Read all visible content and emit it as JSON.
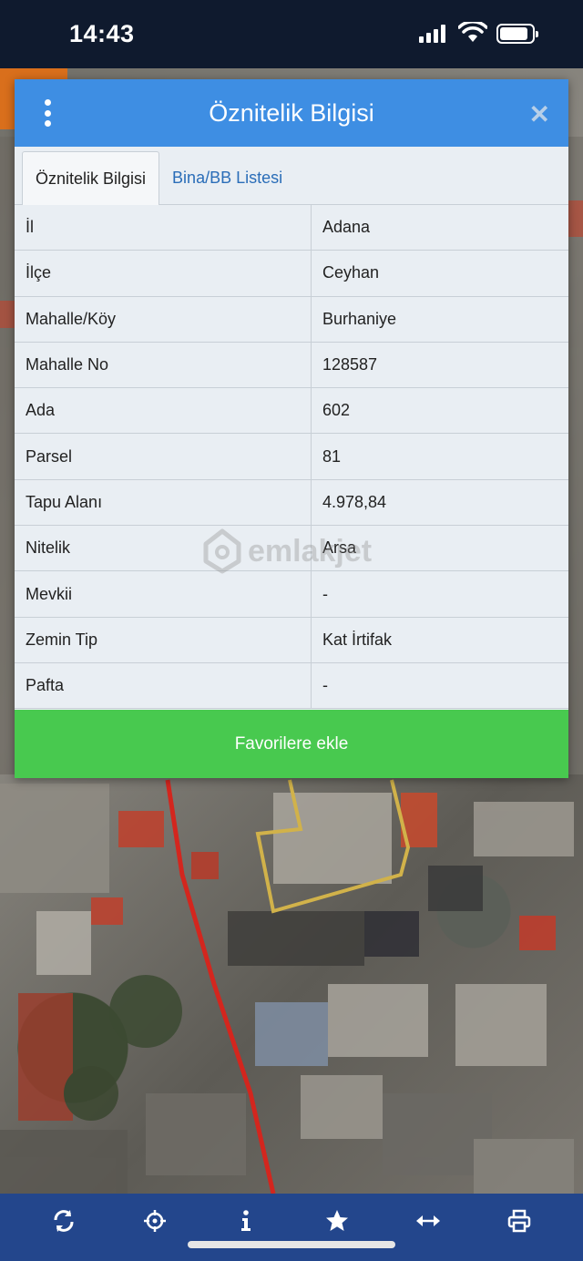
{
  "status_bar": {
    "time": "14:43"
  },
  "dialog": {
    "title": "Öznitelik Bilgisi",
    "tabs": [
      {
        "label": "Öznitelik Bilgisi",
        "active": true
      },
      {
        "label": "Bina/BB Listesi",
        "active": false
      }
    ],
    "rows": [
      {
        "key": "İl",
        "value": "Adana"
      },
      {
        "key": "İlçe",
        "value": "Ceyhan"
      },
      {
        "key": "Mahalle/Köy",
        "value": "Burhaniye"
      },
      {
        "key": "Mahalle No",
        "value": "128587"
      },
      {
        "key": "Ada",
        "value": "602"
      },
      {
        "key": "Parsel",
        "value": "81"
      },
      {
        "key": "Tapu Alanı",
        "value": "4.978,84"
      },
      {
        "key": "Nitelik",
        "value": "Arsa"
      },
      {
        "key": "Mevkii",
        "value": "-"
      },
      {
        "key": "Zemin Tip",
        "value": "Kat İrtifak"
      },
      {
        "key": "Pafta",
        "value": "-"
      }
    ],
    "favorite_button": "Favorilere ekle",
    "header_icons": {
      "menu": "kebab-menu-icon",
      "close": "close-icon"
    }
  },
  "watermark": "emlakjet",
  "toolbar": {
    "icons": [
      "refresh-icon",
      "locate-icon",
      "info-icon",
      "star-icon",
      "measure-icon",
      "print-icon"
    ]
  },
  "colors": {
    "header": "#3e8ee3",
    "favorite": "#48c94f",
    "toolbar": "#23468c",
    "parcel_outline": "#d1b24a",
    "road_line": "#d3261e"
  }
}
